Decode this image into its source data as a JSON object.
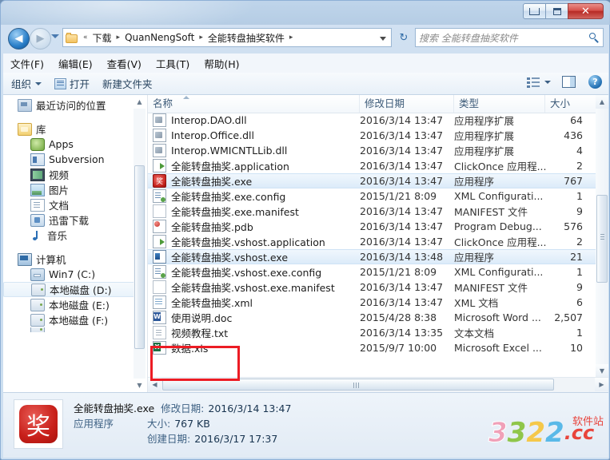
{
  "window": {
    "caption_buttons": {
      "minimize": "—",
      "maximize": "❐",
      "close": "✕"
    }
  },
  "address": {
    "back_glyph": "◀",
    "forward_glyph": "▶",
    "breadcrumb": [
      "下载",
      "QuanNengSoft",
      "全能转盘抽奖软件"
    ],
    "separator": "▸",
    "refresh_glyph": "↻",
    "search_placeholder": "搜索 全能转盘抽奖软件"
  },
  "menubar": {
    "items": [
      "文件(F)",
      "编辑(E)",
      "查看(V)",
      "工具(T)",
      "帮助(H)"
    ]
  },
  "toolbar": {
    "organize": "组织",
    "open": "打开",
    "new_folder": "新建文件夹",
    "help_glyph": "?"
  },
  "navpane": {
    "items": [
      {
        "label": "最近访问的位置",
        "icon": "recent-icon",
        "indent": 1,
        "selected": false
      },
      {
        "label": "库",
        "icon": "library-icon",
        "indent": 1,
        "selected": false
      },
      {
        "label": "Apps",
        "icon": "apps-icon",
        "indent": 2,
        "selected": false
      },
      {
        "label": "Subversion",
        "icon": "subversion-icon",
        "indent": 2,
        "selected": false
      },
      {
        "label": "视频",
        "icon": "video-icon",
        "indent": 2,
        "selected": false
      },
      {
        "label": "图片",
        "icon": "pictures-icon",
        "indent": 2,
        "selected": false
      },
      {
        "label": "文档",
        "icon": "documents-icon",
        "indent": 2,
        "selected": false
      },
      {
        "label": "迅雷下载",
        "icon": "download-icon",
        "indent": 2,
        "selected": false
      },
      {
        "label": "音乐",
        "icon": "music-icon",
        "indent": 2,
        "selected": false
      },
      {
        "label": "计算机",
        "icon": "computer-icon",
        "indent": 1,
        "selected": false
      },
      {
        "label": "Win7 (C:)",
        "icon": "windows-drive-icon",
        "indent": 2,
        "selected": false
      },
      {
        "label": "本地磁盘 (D:)",
        "icon": "disk-icon",
        "indent": 2,
        "selected": true
      },
      {
        "label": "本地磁盘 (E:)",
        "icon": "disk-icon",
        "indent": 2,
        "selected": false
      },
      {
        "label": "本地磁盘 (F:)",
        "icon": "disk-icon",
        "indent": 2,
        "selected": false
      }
    ]
  },
  "filelist": {
    "columns": [
      {
        "label": "名称",
        "key": "name"
      },
      {
        "label": "修改日期",
        "key": "date"
      },
      {
        "label": "类型",
        "key": "type"
      },
      {
        "label": "大小",
        "key": "size"
      }
    ],
    "sort_column": "名称",
    "rows": [
      {
        "name": "Interop.DAO.dll",
        "date": "2016/3/14 13:47",
        "type": "应用程序扩展",
        "size": "64",
        "icon": "dll-icon",
        "selected": false
      },
      {
        "name": "Interop.Office.dll",
        "date": "2016/3/14 13:47",
        "type": "应用程序扩展",
        "size": "436",
        "icon": "dll-icon",
        "selected": false
      },
      {
        "name": "Interop.WMICNTLLib.dll",
        "date": "2016/3/14 13:47",
        "type": "应用程序扩展",
        "size": "4",
        "icon": "dll-icon",
        "selected": false
      },
      {
        "name": "全能转盘抽奖.application",
        "date": "2016/3/14 13:47",
        "type": "ClickOnce 应用程...",
        "size": "2",
        "icon": "clickonce-icon",
        "selected": false
      },
      {
        "name": "全能转盘抽奖.exe",
        "date": "2016/3/14 13:47",
        "type": "应用程序",
        "size": "767",
        "icon": "exe-icon",
        "selected": true
      },
      {
        "name": "全能转盘抽奖.exe.config",
        "date": "2015/1/21 8:09",
        "type": "XML Configurati...",
        "size": "1",
        "icon": "config-icon",
        "selected": false
      },
      {
        "name": "全能转盘抽奖.exe.manifest",
        "date": "2016/3/14 13:47",
        "type": "MANIFEST 文件",
        "size": "9",
        "icon": "manifest-icon",
        "selected": false
      },
      {
        "name": "全能转盘抽奖.pdb",
        "date": "2016/3/14 13:47",
        "type": "Program Debug...",
        "size": "576",
        "icon": "pdb-icon",
        "selected": false
      },
      {
        "name": "全能转盘抽奖.vshost.application",
        "date": "2016/3/14 13:47",
        "type": "ClickOnce 应用程...",
        "size": "2",
        "icon": "clickonce-icon",
        "selected": false
      },
      {
        "name": "全能转盘抽奖.vshost.exe",
        "date": "2016/3/14 13:48",
        "type": "应用程序",
        "size": "21",
        "icon": "vshost-icon",
        "selected": true
      },
      {
        "name": "全能转盘抽奖.vshost.exe.config",
        "date": "2015/1/21 8:09",
        "type": "XML Configurati...",
        "size": "1",
        "icon": "config-icon",
        "selected": false
      },
      {
        "name": "全能转盘抽奖.vshost.exe.manifest",
        "date": "2016/3/14 13:47",
        "type": "MANIFEST 文件",
        "size": "9",
        "icon": "manifest-icon",
        "selected": false
      },
      {
        "name": "全能转盘抽奖.xml",
        "date": "2016/3/14 13:47",
        "type": "XML 文档",
        "size": "6",
        "icon": "xml-icon",
        "selected": false
      },
      {
        "name": "使用说明.doc",
        "date": "2015/4/28 8:38",
        "type": "Microsoft Word ...",
        "size": "2,507",
        "icon": "word-icon",
        "selected": false
      },
      {
        "name": "视频教程.txt",
        "date": "2016/3/14 13:35",
        "type": "文本文档",
        "size": "1",
        "icon": "txt-icon",
        "selected": false
      },
      {
        "name": "数据.xls",
        "date": "2015/9/7 10:00",
        "type": "Microsoft Excel ...",
        "size": "10",
        "icon": "xls-icon",
        "selected": false
      }
    ],
    "annotation": {
      "highlights": [
        "使用说明.doc",
        "视频教程.txt"
      ],
      "color": "#ec1c24"
    }
  },
  "details": {
    "icon_glyph": "奖",
    "filename": "全能转盘抽奖.exe",
    "filetype": "应用程序",
    "modified_label": "修改日期:",
    "modified_value": "2016/3/14 13:47",
    "size_label": "大小:",
    "size_value": "767 KB",
    "created_label": "创建日期:",
    "created_value": "2016/3/17 17:37"
  },
  "watermark": {
    "digit1": "3",
    "digit2": "3",
    "digit3": "2",
    "digit4": "2",
    "dot_cc": ".cc",
    "site_label": "软件站"
  }
}
